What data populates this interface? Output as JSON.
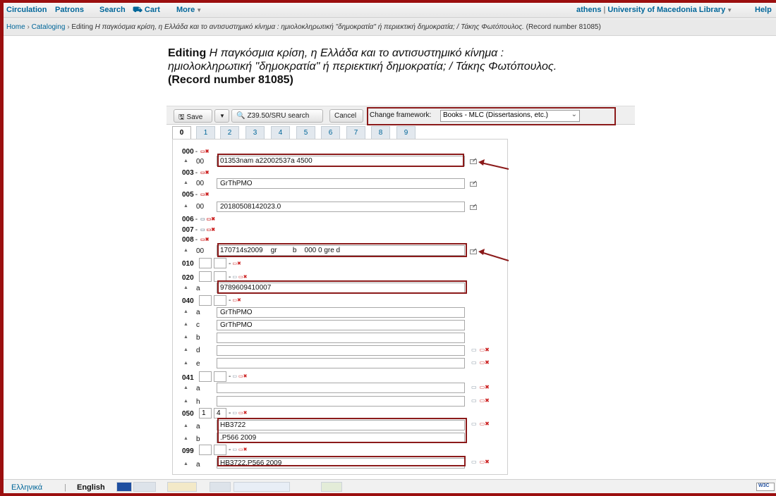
{
  "navbar": {
    "left": [
      "Circulation",
      "Patrons",
      "Search",
      "Cart",
      "More"
    ],
    "user": "athens",
    "library": "University of Macedonia Library",
    "help": "Help"
  },
  "breadcrumb": {
    "home": "Home",
    "cataloging": "Cataloging",
    "editing_prefix": "Editing",
    "record_title": "Η παγκόσμια κρίση, η Ελλάδα και το αντισυστημικό κίνημα : ημιολοκληρωτική \"δημοκρατία\" ή περιεκτική δημοκρατία; / Τάκης Φωτόπουλος.",
    "record_number": "(Record number 81085)"
  },
  "heading": {
    "editing": "Editing",
    "title_line1": "Η παγκόσμια κρίση, η Ελλάδα και το αντισυστημικό κίνημα :",
    "title_line2": "ημιολοκληρωτική \"δημοκρατία\" ή περιεκτική δημοκρατία; / Τάκης Φωτόπουλος.",
    "record_number": "(Record number 81085)"
  },
  "toolbar": {
    "save": "Save",
    "z3950": "Z39.50/SRU search",
    "cancel": "Cancel",
    "framework_label": "Change framework:",
    "framework_value": "Books - MLC (Dissertasions, etc.)"
  },
  "tabs": [
    "0",
    "1",
    "2",
    "3",
    "4",
    "5",
    "6",
    "7",
    "8",
    "9"
  ],
  "marc": {
    "t000": {
      "tag": "000",
      "code": "00",
      "value": "01353nam a22002537a 4500"
    },
    "t003": {
      "tag": "003",
      "code": "00",
      "value": "GrThPMO"
    },
    "t005": {
      "tag": "005",
      "code": "00",
      "value": "20180508142023.0"
    },
    "t006": {
      "tag": "006"
    },
    "t007": {
      "tag": "007"
    },
    "t008": {
      "tag": "008",
      "code": "00",
      "value": "170714s2009    gr        b    000 0 gre d"
    },
    "t010": {
      "tag": "010"
    },
    "t020": {
      "tag": "020",
      "a": "9789609410007"
    },
    "t040": {
      "tag": "040",
      "a": "GrThPMO",
      "c": "GrThPMO"
    },
    "t041": {
      "tag": "041"
    },
    "t050": {
      "tag": "050",
      "ind1": "1",
      "ind2": "4",
      "a": "HB3722",
      "b": ".P566 2009"
    },
    "t099": {
      "tag": "099",
      "a": "HB3722.P566 2009"
    },
    "codes": {
      "a": "a",
      "b": "b",
      "c": "c",
      "d": "d",
      "e": "e",
      "h": "h"
    }
  },
  "footer": {
    "lang_el": "Ελληνικά",
    "lang_sep": "|",
    "lang_en": "English",
    "w3c": "W3C"
  },
  "colors": {
    "highlight": "#8b1a1a",
    "link": "#006699",
    "frame": "#9b0f0f"
  }
}
